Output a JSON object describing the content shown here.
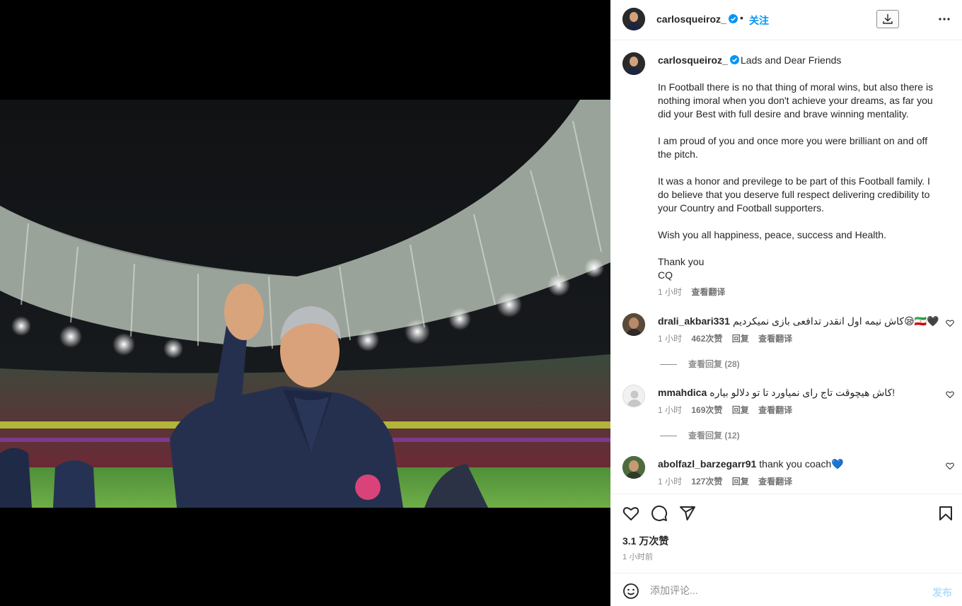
{
  "header": {
    "username": "carlosqueiroz_",
    "separator": "•",
    "follow_label": "关注",
    "download_icon": "download-icon",
    "more_icon": "more-horizontal-icon"
  },
  "caption": {
    "username": "carlosqueiroz_",
    "headline": "Lads and Dear Friends",
    "paragraphs": [
      "In Football there is no that thing of moral wins, but also there is nothing imoral when you don't achieve your dreams, as far you did your Best with full desire and brave winning mentality.",
      "I am proud of you and once more you were brilliant on and off the pitch.",
      "It was a honor and previlege to be part of this Football family. I do believe that you deserve full respect delivering credibility to your Country and Football supporters.",
      "Wish you all happiness, peace, success and Health.",
      "Thank you",
      "CQ"
    ],
    "time": "1 小时",
    "translate": "查看翻译"
  },
  "comments": [
    {
      "username": "drali_akbari331",
      "text": "کاش نیمه اول انقدر تدافعی بازی نمیکردیم😪🇮🇷🖤",
      "time": "1 小时",
      "likes": "462次赞",
      "reply": "回复",
      "translate": "查看翻译",
      "replies": "查看回复 (28)"
    },
    {
      "username": "mmahdica",
      "text": "کاش هیچوقت تاج رای نمیاورد تا تو دلالو بیاره!",
      "time": "1 小时",
      "likes": "169次赞",
      "reply": "回复",
      "translate": "查看翻译",
      "replies": "查看回复 (12)"
    },
    {
      "username": "abolfazl_barzegarr91",
      "text": "thank you coach💙",
      "time": "1 小时",
      "likes": "127次赞",
      "reply": "回复",
      "translate": "查看翻译",
      "replies": ""
    }
  ],
  "actions": {
    "like_icon": "heart-icon",
    "comment_icon": "comment-icon",
    "share_icon": "share-icon",
    "save_icon": "bookmark-icon",
    "likes": "3.1 万次赞",
    "time_ago": "1 小时前"
  },
  "add_comment": {
    "emoji_icon": "emoji-icon",
    "placeholder": "添加评论...",
    "post_label": "发布"
  },
  "colors": {
    "accent": "#0095f6",
    "post_disabled": "#b2dffc",
    "text": "#262626",
    "muted": "#8e8e8e"
  }
}
